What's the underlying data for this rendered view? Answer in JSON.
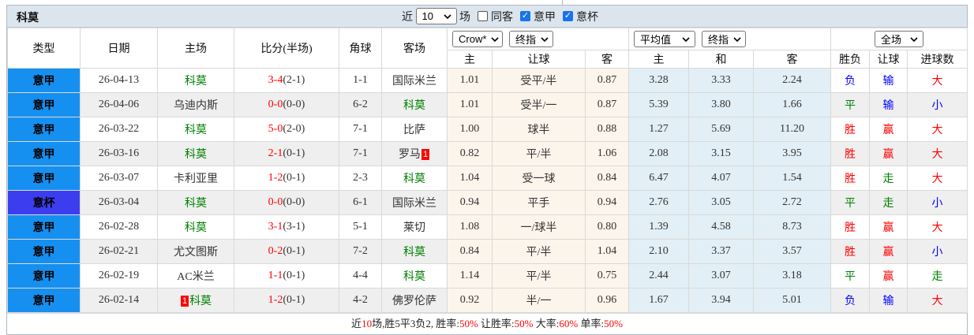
{
  "title": "科莫",
  "filters": {
    "recent_label": "近",
    "recent_value": "10",
    "recent_suffix": "场",
    "checkboxes": [
      {
        "label": "同客",
        "checked": false
      },
      {
        "label": "意甲",
        "checked": true
      },
      {
        "label": "意杯",
        "checked": true
      }
    ]
  },
  "header": {
    "static_cols": [
      "类型",
      "日期",
      "主场",
      "比分(半场)",
      "角球",
      "客场"
    ],
    "groups": [
      {
        "dropdowns": [
          "Crow*",
          "终指"
        ],
        "cols": [
          "主",
          "让球",
          "客"
        ]
      },
      {
        "dropdowns": [
          "平均值",
          "终指"
        ],
        "cols": [
          "主",
          "和",
          "客"
        ]
      },
      {
        "dropdowns": [
          "全场"
        ],
        "cols": [
          "胜负",
          "让球",
          "进球数"
        ]
      }
    ]
  },
  "colors": {
    "league_blue": "#1690f0",
    "cup_blue": "#3d3df0",
    "como_green": "#008000",
    "win_red": "#ff0000",
    "lose_blue": "#0000ff",
    "crow_col_bg": "#fcf5ec",
    "avg_col_bg": "#e2eff6"
  },
  "rows": [
    {
      "type": "意甲",
      "cup": false,
      "date": "26-04-13",
      "home": "科莫",
      "home_como": true,
      "home_badge": "",
      "score_ft": "3-4",
      "score_ht": "(2-1)",
      "corner": "1-1",
      "away": "国际米兰",
      "away_como": false,
      "away_badge": "",
      "crow": [
        "1.01",
        "受平/半",
        "0.87"
      ],
      "avg": [
        "3.28",
        "3.33",
        "2.24"
      ],
      "results": [
        [
          "负",
          "b"
        ],
        [
          "输",
          "b"
        ],
        [
          "大",
          "r"
        ]
      ]
    },
    {
      "type": "意甲",
      "cup": false,
      "date": "26-04-06",
      "home": "乌迪内斯",
      "home_como": false,
      "home_badge": "",
      "score_ft": "0-0",
      "score_ht": "(0-0)",
      "corner": "6-2",
      "away": "科莫",
      "away_como": true,
      "away_badge": "",
      "crow": [
        "1.01",
        "受半/一",
        "0.87"
      ],
      "avg": [
        "5.39",
        "3.80",
        "1.66"
      ],
      "results": [
        [
          "平",
          "g"
        ],
        [
          "输",
          "b"
        ],
        [
          "小",
          "b"
        ]
      ]
    },
    {
      "type": "意甲",
      "cup": false,
      "date": "26-03-22",
      "home": "科莫",
      "home_como": true,
      "home_badge": "",
      "score_ft": "5-0",
      "score_ht": "(2-0)",
      "corner": "7-1",
      "away": "比萨",
      "away_como": false,
      "away_badge": "",
      "crow": [
        "1.00",
        "球半",
        "0.88"
      ],
      "avg": [
        "1.27",
        "5.69",
        "11.20"
      ],
      "results": [
        [
          "胜",
          "r"
        ],
        [
          "赢",
          "r"
        ],
        [
          "大",
          "r"
        ]
      ]
    },
    {
      "type": "意甲",
      "cup": false,
      "date": "26-03-16",
      "home": "科莫",
      "home_como": true,
      "home_badge": "",
      "score_ft": "2-1",
      "score_ht": "(0-1)",
      "corner": "7-1",
      "away": "罗马",
      "away_como": false,
      "away_badge": "1",
      "crow": [
        "0.82",
        "平/半",
        "1.06"
      ],
      "avg": [
        "2.08",
        "3.15",
        "3.95"
      ],
      "results": [
        [
          "胜",
          "r"
        ],
        [
          "赢",
          "r"
        ],
        [
          "大",
          "r"
        ]
      ]
    },
    {
      "type": "意甲",
      "cup": false,
      "date": "26-03-07",
      "home": "卡利亚里",
      "home_como": false,
      "home_badge": "",
      "score_ft": "1-2",
      "score_ht": "(0-1)",
      "corner": "2-3",
      "away": "科莫",
      "away_como": true,
      "away_badge": "",
      "crow": [
        "1.04",
        "受一球",
        "0.84"
      ],
      "avg": [
        "6.47",
        "4.07",
        "1.54"
      ],
      "results": [
        [
          "胜",
          "r"
        ],
        [
          "走",
          "g"
        ],
        [
          "大",
          "r"
        ]
      ]
    },
    {
      "type": "意杯",
      "cup": true,
      "date": "26-03-04",
      "home": "科莫",
      "home_como": true,
      "home_badge": "",
      "score_ft": "0-0",
      "score_ht": "(0-0)",
      "corner": "6-1",
      "away": "国际米兰",
      "away_como": false,
      "away_badge": "",
      "crow": [
        "0.94",
        "平手",
        "0.94"
      ],
      "avg": [
        "2.76",
        "3.05",
        "2.72"
      ],
      "results": [
        [
          "平",
          "g"
        ],
        [
          "走",
          "g"
        ],
        [
          "小",
          "b"
        ]
      ]
    },
    {
      "type": "意甲",
      "cup": false,
      "date": "26-02-28",
      "home": "科莫",
      "home_como": true,
      "home_badge": "",
      "score_ft": "3-1",
      "score_ht": "(3-1)",
      "corner": "5-1",
      "away": "莱切",
      "away_como": false,
      "away_badge": "",
      "crow": [
        "1.08",
        "一/球半",
        "0.80"
      ],
      "avg": [
        "1.39",
        "4.58",
        "8.73"
      ],
      "results": [
        [
          "胜",
          "r"
        ],
        [
          "赢",
          "r"
        ],
        [
          "大",
          "r"
        ]
      ]
    },
    {
      "type": "意甲",
      "cup": false,
      "date": "26-02-21",
      "home": "尤文图斯",
      "home_como": false,
      "home_badge": "",
      "score_ft": "0-2",
      "score_ht": "(0-1)",
      "corner": "7-2",
      "away": "科莫",
      "away_como": true,
      "away_badge": "",
      "crow": [
        "0.84",
        "平/半",
        "1.04"
      ],
      "avg": [
        "2.10",
        "3.37",
        "3.57"
      ],
      "results": [
        [
          "胜",
          "r"
        ],
        [
          "赢",
          "r"
        ],
        [
          "小",
          "b"
        ]
      ]
    },
    {
      "type": "意甲",
      "cup": false,
      "date": "26-02-19",
      "home": "AC米兰",
      "home_como": false,
      "home_badge": "",
      "score_ft": "1-1",
      "score_ht": "(0-1)",
      "corner": "4-4",
      "away": "科莫",
      "away_como": true,
      "away_badge": "",
      "crow": [
        "1.14",
        "平/半",
        "0.75"
      ],
      "avg": [
        "2.44",
        "3.07",
        "3.18"
      ],
      "results": [
        [
          "平",
          "g"
        ],
        [
          "赢",
          "r"
        ],
        [
          "走",
          "g"
        ]
      ]
    },
    {
      "type": "意甲",
      "cup": false,
      "date": "26-02-14",
      "home": "科莫",
      "home_como": true,
      "home_badge": "1",
      "score_ft": "1-2",
      "score_ht": "(0-1)",
      "corner": "4-2",
      "away": "佛罗伦萨",
      "away_como": false,
      "away_badge": "",
      "crow": [
        "0.92",
        "半/一",
        "0.96"
      ],
      "avg": [
        "1.67",
        "3.94",
        "5.01"
      ],
      "results": [
        [
          "负",
          "b"
        ],
        [
          "输",
          "b"
        ],
        [
          "大",
          "r"
        ]
      ]
    }
  ],
  "footer": {
    "segments": [
      [
        "近",
        "k"
      ],
      [
        "10",
        "r"
      ],
      [
        "场,胜5平3负2, 胜率:",
        "k"
      ],
      [
        "50%",
        "r"
      ],
      [
        " 让胜率:",
        "k"
      ],
      [
        "50%",
        "r"
      ],
      [
        " 大率:",
        "k"
      ],
      [
        "60%",
        "r"
      ],
      [
        " 单率:",
        "k"
      ],
      [
        "50%",
        "r"
      ]
    ]
  }
}
